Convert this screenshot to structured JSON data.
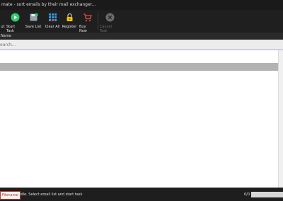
{
  "window": {
    "title": "mate - sort emails by their mail exchanger..."
  },
  "toolbar": {
    "buttons": [
      {
        "label": "ut",
        "icon": "exit-icon"
      },
      {
        "label": "Start Task",
        "icon": "play-icon"
      },
      {
        "label": "Save List",
        "icon": "save-list-icon"
      },
      {
        "label": "Clear All",
        "icon": "grid-icon"
      },
      {
        "label": "Register",
        "icon": "lock-icon"
      },
      {
        "label": "Buy Now",
        "icon": "cart-icon"
      },
      {
        "label": "Cancel Task",
        "icon": "cancel-icon",
        "disabled": true
      }
    ]
  },
  "list": {
    "column_header": "Name",
    "search_placeholder": "earch...",
    "selected_row_text": ""
  },
  "status": {
    "filename_label": "Filename",
    "message": "Idle. Select email list and start task",
    "count": "0/0",
    "progress": 0
  },
  "colors": {
    "play": "#2ecc71",
    "cart": "#e74c3c",
    "lock": "#f1c40f",
    "grid": "#3498db"
  }
}
